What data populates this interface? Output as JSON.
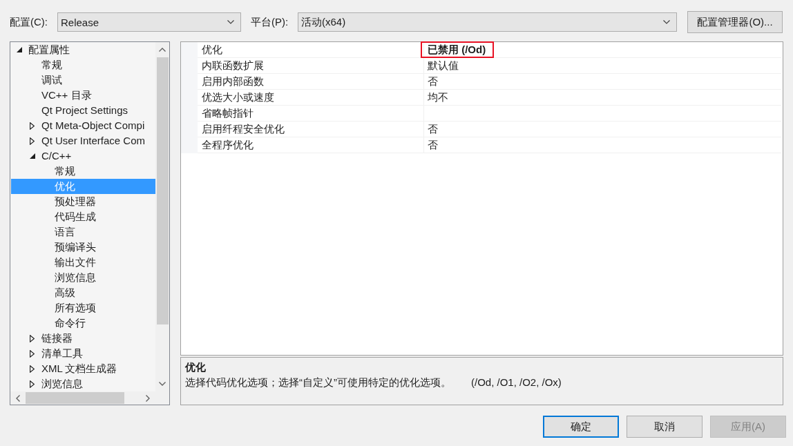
{
  "toolbar": {
    "configuration": {
      "label": "配置(C):",
      "value": "Release"
    },
    "platform": {
      "label": "平台(P):",
      "value": "活动(x64)"
    },
    "manager_button": "配置管理器(O)..."
  },
  "tree": [
    {
      "label": "配置属性",
      "expanded": true,
      "selected": false,
      "children": [
        {
          "label": "常规",
          "selected": false
        },
        {
          "label": "调试",
          "selected": false
        },
        {
          "label": "VC++ 目录",
          "selected": false
        },
        {
          "label": "Qt Project Settings",
          "selected": false
        },
        {
          "label": "Qt Meta-Object Compi",
          "expanded": false,
          "selected": false
        },
        {
          "label": "Qt User Interface Com",
          "expanded": false,
          "selected": false
        },
        {
          "label": "C/C++",
          "expanded": true,
          "selected": false,
          "children": [
            {
              "label": "常规",
              "selected": false
            },
            {
              "label": "优化",
              "selected": true
            },
            {
              "label": "预处理器",
              "selected": false
            },
            {
              "label": "代码生成",
              "selected": false
            },
            {
              "label": "语言",
              "selected": false
            },
            {
              "label": "预编译头",
              "selected": false
            },
            {
              "label": "输出文件",
              "selected": false
            },
            {
              "label": "浏览信息",
              "selected": false
            },
            {
              "label": "高级",
              "selected": false
            },
            {
              "label": "所有选项",
              "selected": false
            },
            {
              "label": "命令行",
              "selected": false
            }
          ]
        },
        {
          "label": "链接器",
          "expanded": false,
          "selected": false
        },
        {
          "label": "清单工具",
          "expanded": false,
          "selected": false
        },
        {
          "label": "XML 文档生成器",
          "expanded": false,
          "selected": false
        },
        {
          "label": "浏览信息",
          "expanded": false,
          "selected": false
        }
      ]
    }
  ],
  "properties": [
    {
      "name": "优化",
      "value": "已禁用 (/Od)",
      "bold": true,
      "highlighted": true
    },
    {
      "name": "内联函数扩展",
      "value": "默认值",
      "bold": false,
      "highlighted": false
    },
    {
      "name": "启用内部函数",
      "value": "否",
      "bold": false,
      "highlighted": false
    },
    {
      "name": "优选大小或速度",
      "value": "均不",
      "bold": false,
      "highlighted": false
    },
    {
      "name": "省略帧指针"
    },
    {
      "name": "启用纤程安全优化",
      "value": "否",
      "bold": false,
      "highlighted": false
    },
    {
      "name": "全程序优化",
      "value": "否",
      "bold": false,
      "highlighted": false
    }
  ],
  "description": {
    "title": "优化",
    "text": "选择代码优化选项；选择“自定义”可使用特定的优化选项。",
    "switches": "(/Od, /O1, /O2, /Ox)"
  },
  "buttons": [
    {
      "label": "确定",
      "default": true,
      "disabled": false
    },
    {
      "label": "取消",
      "default": false,
      "disabled": false
    },
    {
      "label": "应用(A)",
      "default": false,
      "disabled": true
    }
  ]
}
